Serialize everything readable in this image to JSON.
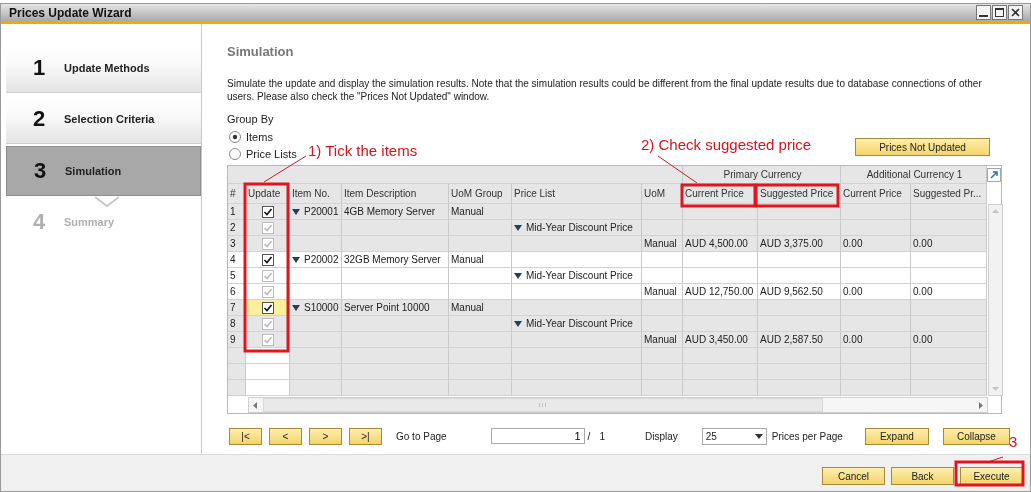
{
  "window": {
    "title": "Prices Update Wizard"
  },
  "steps": [
    {
      "number": "1",
      "label": "Update Methods",
      "selected": false,
      "disabled": false
    },
    {
      "number": "2",
      "label": "Selection Criteria",
      "selected": false,
      "disabled": false
    },
    {
      "number": "3",
      "label": "Simulation",
      "selected": true,
      "disabled": false
    },
    {
      "number": "4",
      "label": "Summary",
      "selected": false,
      "disabled": true
    }
  ],
  "page": {
    "title": "Simulation",
    "description": "Simulate the update and display the simulation results. Note that the simulation results could be different from the final update results due to database connections of other users. Please also check the \"Prices Not Updated\" window."
  },
  "group_by": {
    "label": "Group By",
    "options": [
      {
        "label": "Items",
        "selected": true
      },
      {
        "label": "Price Lists",
        "selected": false
      }
    ]
  },
  "prices_not_updated_button": "Prices Not Updated",
  "table": {
    "column_groups": [
      "Primary Currency",
      "Additional Currency 1"
    ],
    "columns": [
      "#",
      "Update",
      "Item No.",
      "Item Description",
      "UoM Group",
      "Price List",
      "UoM",
      "Current Price",
      "Suggested Price",
      "Current Price",
      "Suggested Pr..."
    ],
    "rows": [
      {
        "number": "1",
        "kind": "item",
        "checked": true,
        "disabled": false,
        "focused": false,
        "expanded": true,
        "item_no": "P20001",
        "description": "4GB Memory Server",
        "uom_group": "Manual"
      },
      {
        "number": "2",
        "kind": "price_list",
        "checked": true,
        "disabled": true,
        "focused": false,
        "expanded": true,
        "price_list": "Mid-Year Discount Price"
      },
      {
        "number": "3",
        "kind": "price",
        "checked": true,
        "disabled": true,
        "focused": false,
        "uom": "Manual",
        "current_price": "AUD 4,500.00",
        "suggested_price": "AUD 3,375.00",
        "add_current_price": "0.00",
        "add_suggested_price": "0.00"
      },
      {
        "number": "4",
        "kind": "item",
        "checked": true,
        "disabled": false,
        "focused": false,
        "expanded": true,
        "item_no": "P20002",
        "description": "32GB Memory Server",
        "uom_group": "Manual"
      },
      {
        "number": "5",
        "kind": "price_list",
        "checked": true,
        "disabled": true,
        "focused": false,
        "expanded": true,
        "price_list": "Mid-Year Discount Price"
      },
      {
        "number": "6",
        "kind": "price",
        "checked": true,
        "disabled": true,
        "focused": false,
        "uom": "Manual",
        "current_price": "AUD 12,750.00",
        "suggested_price": "AUD 9,562.50",
        "add_current_price": "0.00",
        "add_suggested_price": "0.00"
      },
      {
        "number": "7",
        "kind": "item",
        "checked": true,
        "disabled": false,
        "focused": true,
        "expanded": true,
        "item_no": "S10000",
        "description": "Server Point 10000",
        "uom_group": "Manual"
      },
      {
        "number": "8",
        "kind": "price_list",
        "checked": true,
        "disabled": true,
        "focused": false,
        "expanded": true,
        "price_list": "Mid-Year Discount Price"
      },
      {
        "number": "9",
        "kind": "price",
        "checked": true,
        "disabled": true,
        "focused": false,
        "uom": "Manual",
        "current_price": "AUD 3,450.00",
        "suggested_price": "AUD 2,587.50",
        "add_current_price": "0.00",
        "add_suggested_price": "0.00"
      }
    ]
  },
  "pager": {
    "first": "|<",
    "prev": "<",
    "next": ">",
    "last": ">|",
    "go_to_label": "Go to Page",
    "page": "1",
    "separator": "/",
    "page_count": "1",
    "display_label": "Display",
    "page_size": "25",
    "per_page_label": "Prices per Page",
    "expand": "Expand",
    "collapse": "Collapse"
  },
  "footer_buttons": [
    "Cancel",
    "Back",
    "Execute"
  ],
  "annotations": [
    {
      "text": "1) Tick the items"
    },
    {
      "text": "2) Check suggested price"
    },
    {
      "text": "3"
    }
  ]
}
